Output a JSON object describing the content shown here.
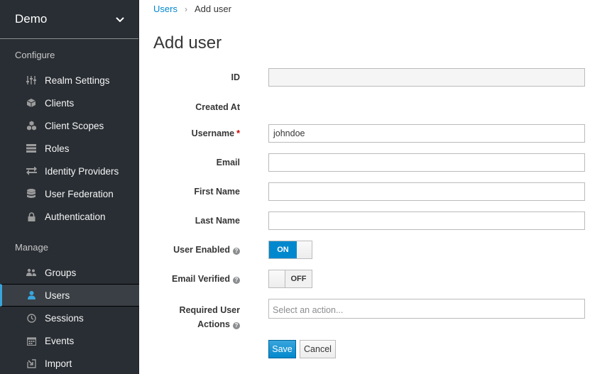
{
  "realm": {
    "name": "Demo"
  },
  "sidebar": {
    "configure_title": "Configure",
    "configure_items": [
      {
        "label": "Realm Settings",
        "icon": "sliders-icon"
      },
      {
        "label": "Clients",
        "icon": "cube-icon"
      },
      {
        "label": "Client Scopes",
        "icon": "cubes-icon"
      },
      {
        "label": "Roles",
        "icon": "list-icon"
      },
      {
        "label": "Identity Providers",
        "icon": "exchange-icon"
      },
      {
        "label": "User Federation",
        "icon": "database-icon"
      },
      {
        "label": "Authentication",
        "icon": "lock-icon"
      }
    ],
    "manage_title": "Manage",
    "manage_items": [
      {
        "label": "Groups",
        "icon": "users-icon"
      },
      {
        "label": "Users",
        "icon": "user-icon",
        "active": true
      },
      {
        "label": "Sessions",
        "icon": "clock-icon"
      },
      {
        "label": "Events",
        "icon": "calendar-icon"
      },
      {
        "label": "Import",
        "icon": "import-icon"
      }
    ]
  },
  "breadcrumb": {
    "parent": "Users",
    "current": "Add user"
  },
  "page_title": "Add user",
  "form": {
    "id_label": "ID",
    "id_value": "",
    "created_at_label": "Created At",
    "username_label": "Username",
    "username_value": "johndoe",
    "email_label": "Email",
    "email_value": "",
    "first_name_label": "First Name",
    "first_name_value": "",
    "last_name_label": "Last Name",
    "last_name_value": "",
    "user_enabled_label": "User Enabled",
    "user_enabled_state": "ON",
    "email_verified_label": "Email Verified",
    "email_verified_state": "OFF",
    "required_actions_label_1": "Required User",
    "required_actions_label_2": "Actions",
    "required_actions_placeholder": "Select an action..."
  },
  "buttons": {
    "save": "Save",
    "cancel": "Cancel"
  },
  "colors": {
    "sidebar_bg": "#292e34",
    "accent": "#0088ce",
    "active_border": "#39a5dc"
  }
}
